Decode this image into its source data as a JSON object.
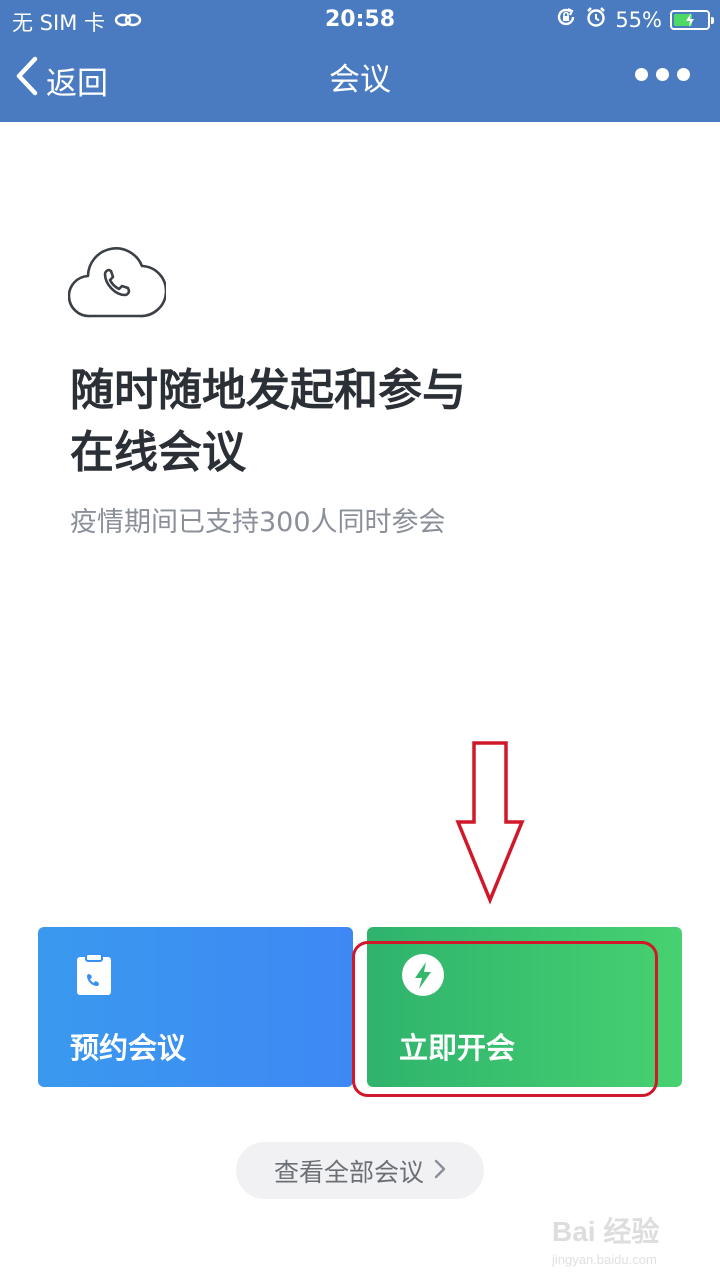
{
  "status_bar": {
    "carrier": "无 SIM 卡",
    "time": "20:58",
    "battery_percent": "55%",
    "battery_level": 0.55
  },
  "nav": {
    "back_label": "返回",
    "title": "会议"
  },
  "main": {
    "headline_line1": "随时随地发起和参与",
    "headline_line2": "在线会议",
    "subtext": "疫情期间已支持300人同时参会"
  },
  "actions": {
    "schedule_label": "预约会议",
    "start_label": "立即开会",
    "view_all_label": "查看全部会议"
  },
  "watermark": {
    "brand": "Bai 经验",
    "url": "jingyan.baidu.com"
  },
  "colors": {
    "header": "#4a7bc0",
    "schedule_card": "#3a90f0",
    "start_card": "#3cc46e",
    "annotation_red": "#d0182a"
  }
}
